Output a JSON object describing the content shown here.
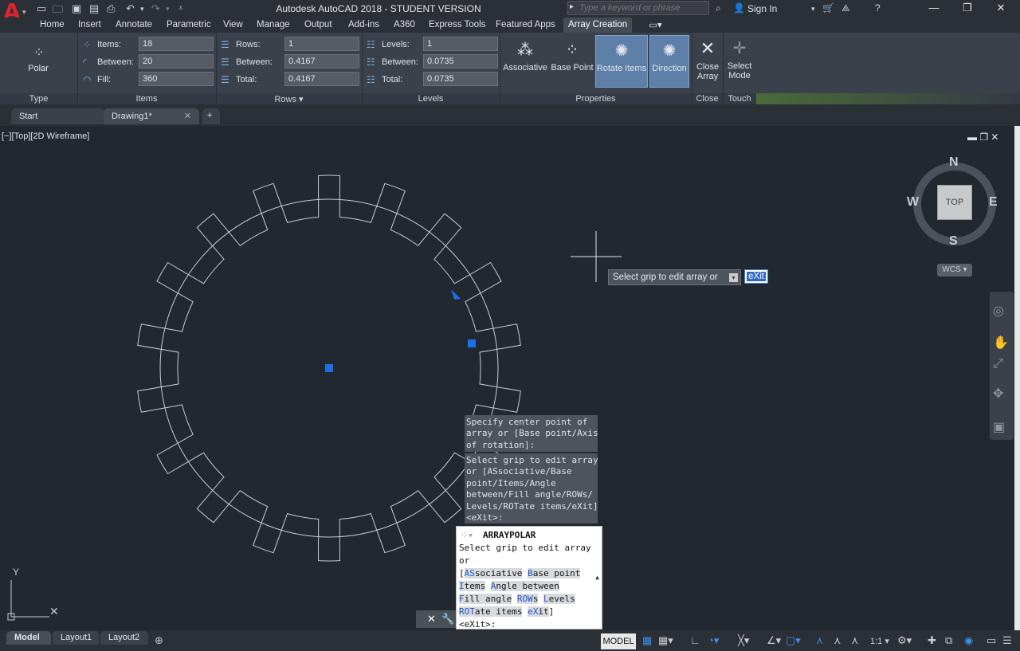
{
  "title_bar": {
    "app_logo": "A",
    "title": "Autodesk AutoCAD 2018 - STUDENT VERSION",
    "search_placeholder": "Type a keyword or phrase",
    "sign_in": "Sign In"
  },
  "ribbon_tabs": [
    "Home",
    "Insert",
    "Annotate",
    "Parametric",
    "View",
    "Manage",
    "Output",
    "Add-ins",
    "A360",
    "Express Tools",
    "Featured Apps",
    "Array Creation"
  ],
  "active_tab": "Array Creation",
  "ribbon": {
    "type_panel": {
      "button": "Polar",
      "label": "Type"
    },
    "items_panel": {
      "items_label": "Items:",
      "items_value": "18",
      "between_label": "Between:",
      "between_value": "20",
      "fill_label": "Fill:",
      "fill_value": "360",
      "label": "Items"
    },
    "rows_panel": {
      "rows_label": "Rows:",
      "rows_value": "1",
      "between_label": "Between:",
      "between_value": "0.4167",
      "total_label": "Total:",
      "total_value": "0.4167",
      "label": "Rows"
    },
    "levels_panel": {
      "levels_label": "Levels:",
      "levels_value": "1",
      "between_label": "Between:",
      "between_value": "0.0735",
      "total_label": "Total:",
      "total_value": "0.0735",
      "label": "Levels"
    },
    "properties_panel": {
      "associative": "Associative",
      "base_point": "Base Point",
      "rotate_items": "Rotate Items",
      "direction": "Direction",
      "label": "Properties"
    },
    "close_panel": {
      "button_line1": "Close",
      "button_line2": "Array",
      "label": "Close"
    },
    "touch_panel": {
      "button_line1": "Select",
      "button_line2": "Mode",
      "label": "Touch"
    }
  },
  "doc_tabs": [
    "Start",
    "Drawing1*"
  ],
  "viewport": {
    "label": "[−][Top][2D Wireframe]",
    "viewcube": {
      "face": "TOP",
      "n": "N",
      "s": "S",
      "e": "E",
      "w": "W",
      "wcs": "WCS"
    },
    "ucs_y": "Y"
  },
  "tooltip": {
    "prompt": "Select grip to edit array or",
    "input": "eXit"
  },
  "history": {
    "line1": "Specify center point of\narray or [Base point/Axis\nof rotation]:",
    "line2": "Select grip to edit array\nor [ASsociative/Base\npoint/Items/Angle\nbetween/Fill angle/ROWs/\nLevels/ROTate items/eXit]\n<eXit>:"
  },
  "command_line": {
    "title": "ARRAYPOLAR",
    "prompt1": "Select grip to edit array",
    "prompt2": "or",
    "opt_as_k": "AS",
    "opt_as_r": "sociative",
    "opt_bp_k": "B",
    "opt_bp_r": "ase point",
    "opt_items_k": "I",
    "opt_items_r": "tems",
    "opt_angle_k": "A",
    "opt_angle_r": "ngle between",
    "opt_fill_k": "F",
    "opt_fill_r": "ill angle",
    "opt_rows_k": "ROW",
    "opt_rows_r": "s",
    "opt_levels_k": "L",
    "opt_levels_r": "evels",
    "opt_rot_k": "ROT",
    "opt_rot_r": "ate items",
    "opt_exit_k": "eX",
    "opt_exit_r": "it",
    "default": "<eXit>:"
  },
  "status_bar": {
    "layout_tabs": [
      "Model",
      "Layout1",
      "Layout2"
    ],
    "model_button": "MODEL",
    "scale": "1:1"
  },
  "gear": {
    "teeth": 18
  }
}
